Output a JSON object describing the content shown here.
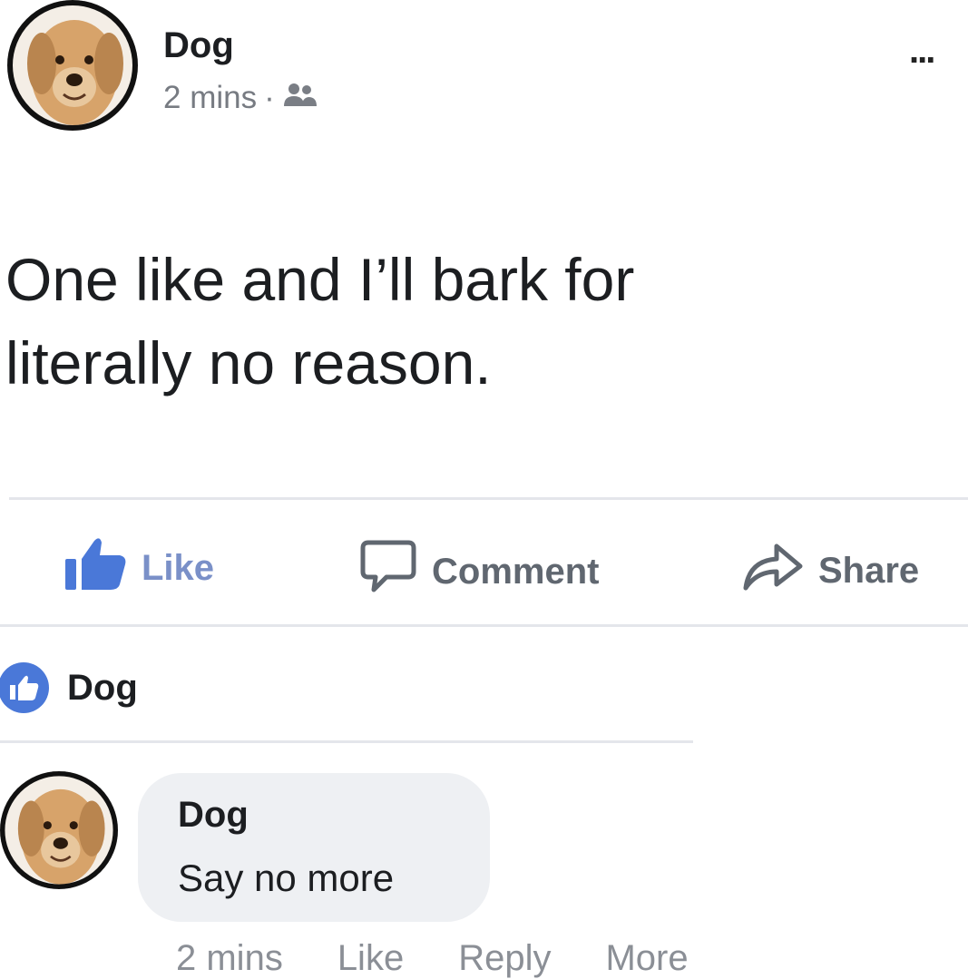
{
  "post": {
    "author": "Dog",
    "timestamp": "2 mins",
    "separator": "·",
    "audience_icon": "friends-icon",
    "more_label": "...",
    "text": "One like and I’ll bark for\nliterally no reason."
  },
  "actions": {
    "like_label": "Like",
    "comment_label": "Comment",
    "share_label": "Share"
  },
  "likes": {
    "icon": "thumbs-up-badge-icon",
    "name": "Dog"
  },
  "comment": {
    "author": "Dog",
    "text": "Say no more",
    "timestamp": "2 mins",
    "like_label": "Like",
    "reply_label": "Reply",
    "more_label": "More"
  },
  "colors": {
    "like_blue": "#4a78d8",
    "muted_text": "#777b82",
    "bubble_bg": "#eef0f3"
  }
}
